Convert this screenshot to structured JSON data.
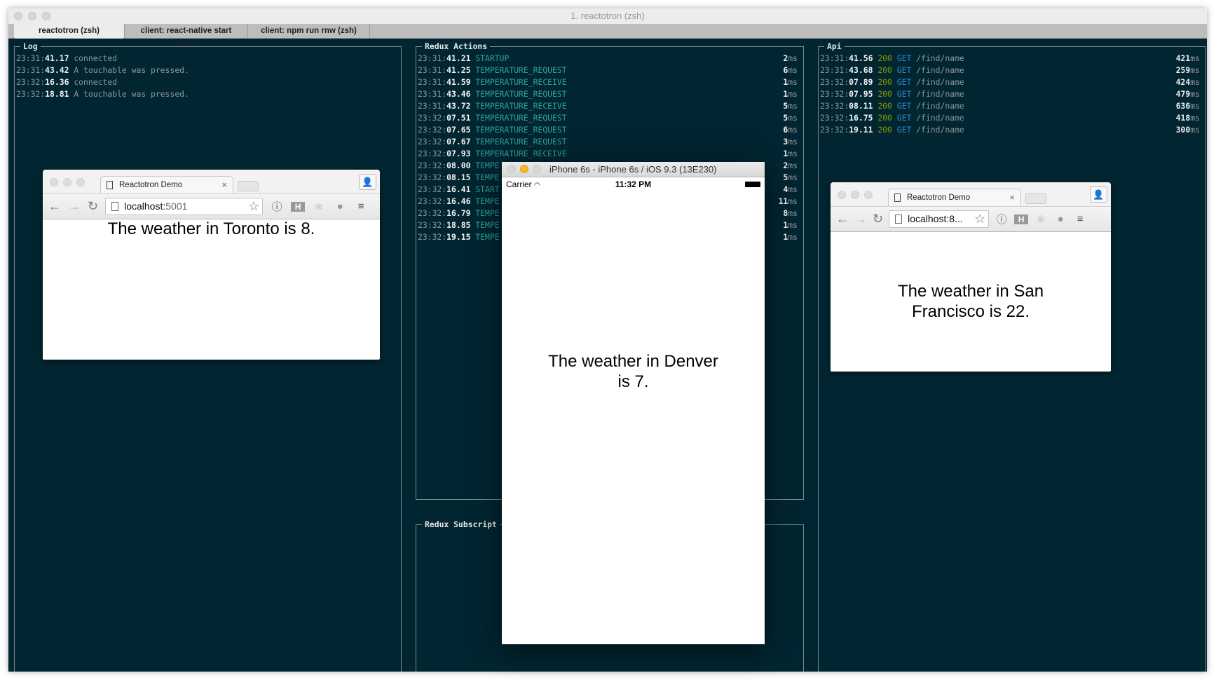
{
  "window": {
    "title": "1. reactotron (zsh)",
    "tabs": [
      "reactotron (zsh)",
      "client: react-native start (no...",
      "client: npm run rnw (zsh)"
    ]
  },
  "log": {
    "title": "Log",
    "rows": [
      {
        "prefix": "23:31:",
        "sec": "41.17",
        "msg": "connected"
      },
      {
        "prefix": "23:31:",
        "sec": "43.42",
        "msg": "A touchable was pressed."
      },
      {
        "prefix": "23:32:",
        "sec": "16.36",
        "msg": "connected"
      },
      {
        "prefix": "23:32:",
        "sec": "18.81",
        "msg": "A touchable was pressed."
      }
    ]
  },
  "redux_actions": {
    "title": "Redux Actions",
    "unit": "ms",
    "rows": [
      {
        "prefix": "23:31:",
        "sec": "41.21",
        "action": "STARTUP",
        "ms": "2"
      },
      {
        "prefix": "23:31:",
        "sec": "41.25",
        "action": "TEMPERATURE_REQUEST",
        "ms": "6"
      },
      {
        "prefix": "23:31:",
        "sec": "41.59",
        "action": "TEMPERATURE_RECEIVE",
        "ms": "1"
      },
      {
        "prefix": "23:31:",
        "sec": "43.46",
        "action": "TEMPERATURE_REQUEST",
        "ms": "1"
      },
      {
        "prefix": "23:31:",
        "sec": "43.72",
        "action": "TEMPERATURE_RECEIVE",
        "ms": "5"
      },
      {
        "prefix": "23:32:",
        "sec": "07.51",
        "action": "TEMPERATURE_REQUEST",
        "ms": "5"
      },
      {
        "prefix": "23:32:",
        "sec": "07.65",
        "action": "TEMPERATURE_REQUEST",
        "ms": "6"
      },
      {
        "prefix": "23:32:",
        "sec": "07.67",
        "action": "TEMPERATURE_REQUEST",
        "ms": "3"
      },
      {
        "prefix": "23:32:",
        "sec": "07.93",
        "action": "TEMPERATURE_RECEIVE",
        "ms": "1"
      },
      {
        "prefix": "23:32:",
        "sec": "08.00",
        "action": "TEMPE",
        "ms": "2"
      },
      {
        "prefix": "23:32:",
        "sec": "08.15",
        "action": "TEMPE",
        "ms": "5"
      },
      {
        "prefix": "23:32:",
        "sec": "16.41",
        "action": "START",
        "ms": "4"
      },
      {
        "prefix": "23:32:",
        "sec": "16.46",
        "action": "TEMPE",
        "ms": "11"
      },
      {
        "prefix": "23:32:",
        "sec": "16.79",
        "action": "TEMPE",
        "ms": "8"
      },
      {
        "prefix": "23:32:",
        "sec": "18.85",
        "action": "TEMPE",
        "ms": "1"
      },
      {
        "prefix": "23:32:",
        "sec": "19.15",
        "action": "TEMPE",
        "ms": "1"
      }
    ]
  },
  "redux_subscriptions": {
    "title": "Redux Subscript"
  },
  "api": {
    "title": "Api",
    "unit": "ms",
    "rows": [
      {
        "prefix": "23:31:",
        "sec": "41.56",
        "status": "200",
        "method": "GET",
        "path": "/find/name",
        "ms": "421"
      },
      {
        "prefix": "23:31:",
        "sec": "43.68",
        "status": "200",
        "method": "GET",
        "path": "/find/name",
        "ms": "259"
      },
      {
        "prefix": "23:32:",
        "sec": "07.89",
        "status": "200",
        "method": "GET",
        "path": "/find/name",
        "ms": "424"
      },
      {
        "prefix": "23:32:",
        "sec": "07.95",
        "status": "200",
        "method": "GET",
        "path": "/find/name",
        "ms": "479"
      },
      {
        "prefix": "23:32:",
        "sec": "08.11",
        "status": "200",
        "method": "GET",
        "path": "/find/name",
        "ms": "636"
      },
      {
        "prefix": "23:32:",
        "sec": "16.75",
        "status": "200",
        "method": "GET",
        "path": "/find/name",
        "ms": "418"
      },
      {
        "prefix": "23:32:",
        "sec": "19.11",
        "status": "200",
        "method": "GET",
        "path": "/find/name",
        "ms": "300"
      }
    ]
  },
  "browser_toronto": {
    "tab": "Reactotron Demo",
    "url_host": "localhost:",
    "url_port": "5001",
    "content": "The weather in Toronto is 8."
  },
  "browser_sf": {
    "tab": "Reactotron Demo",
    "url_host": "localhost:8...",
    "url_port": "",
    "content_1": "The weather in San",
    "content_2": "Francisco is 22."
  },
  "simulator": {
    "title": "iPhone 6s - iPhone 6s / iOS 9.3 (13E230)",
    "carrier": "Carrier",
    "time": "11:32 PM",
    "content_1": "The weather in Denver",
    "content_2": "is 7."
  },
  "colors": {
    "background": "#022631",
    "action": "#2aa198",
    "status": "#859900",
    "method": "#268bd2"
  }
}
